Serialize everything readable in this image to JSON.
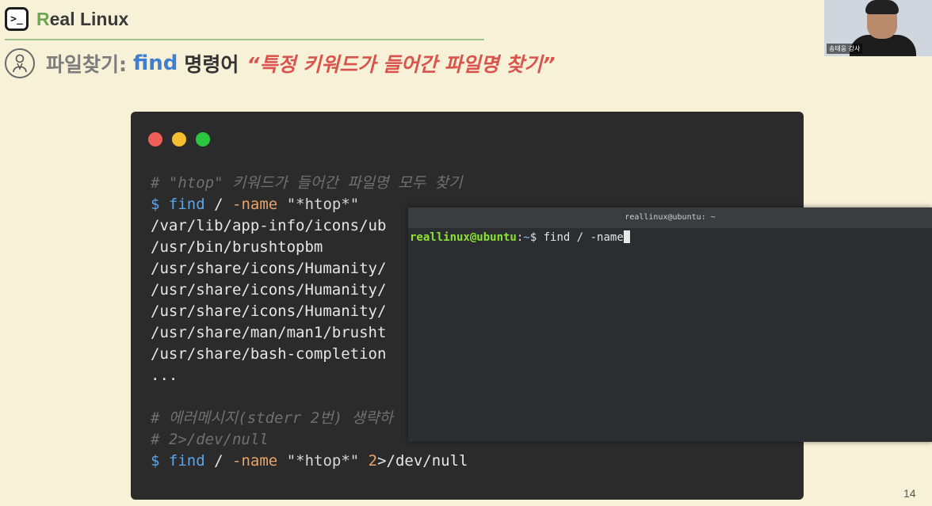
{
  "brand": {
    "r": "R",
    "rest": "eal Linux",
    "icon_glyph": ">_"
  },
  "title": {
    "icon": "person-icon",
    "prefix": "파일찾기:",
    "cmd": "find",
    "word": "명령어",
    "quote": "“특정 키워드가 들어간 파일명 찾기”"
  },
  "webcam": {
    "name_tag": "송태웅 강사"
  },
  "code_window": {
    "lines": [
      {
        "kind": "comment",
        "text": "# \"htop\" 키워드가 들어간 파일명 모두 찾기"
      },
      {
        "kind": "cmd",
        "prompt": "$",
        "cmd": "find",
        "path": "/",
        "flag": "-name",
        "arg": "\"*htop*\"",
        "extra": ""
      },
      {
        "kind": "out",
        "text": "/var/lib/app-info/icons/ub"
      },
      {
        "kind": "out",
        "text": "/usr/bin/brushtopbm"
      },
      {
        "kind": "out",
        "text": "/usr/share/icons/Humanity/"
      },
      {
        "kind": "out",
        "text": "/usr/share/icons/Humanity/"
      },
      {
        "kind": "out",
        "text": "/usr/share/icons/Humanity/"
      },
      {
        "kind": "out",
        "text": "/usr/share/man/man1/brusht"
      },
      {
        "kind": "out",
        "text": "/usr/share/bash-completion"
      },
      {
        "kind": "out",
        "text": "..."
      },
      {
        "kind": "blank",
        "text": ""
      },
      {
        "kind": "comment",
        "text": "# 에러메시지(stderr 2번) 생략하"
      },
      {
        "kind": "comment",
        "text": "# 2>/dev/null"
      },
      {
        "kind": "cmd",
        "prompt": "$",
        "cmd": "find",
        "path": "/",
        "flag": "-name",
        "arg": "\"*htop*\"",
        "extra_num": "2",
        "extra": ">/dev/null"
      }
    ]
  },
  "terminal": {
    "title": "reallinux@ubuntu: ~",
    "user": "reallinux@ubuntu",
    "sep": ":",
    "path": "~",
    "prompt_char": "$",
    "input": " find / -name"
  },
  "page_number": "14",
  "colors": {
    "background": "#f7f1d8",
    "accent_green": "#6fa355",
    "accent_blue": "#3e7fd0",
    "accent_red": "#d9544d"
  }
}
